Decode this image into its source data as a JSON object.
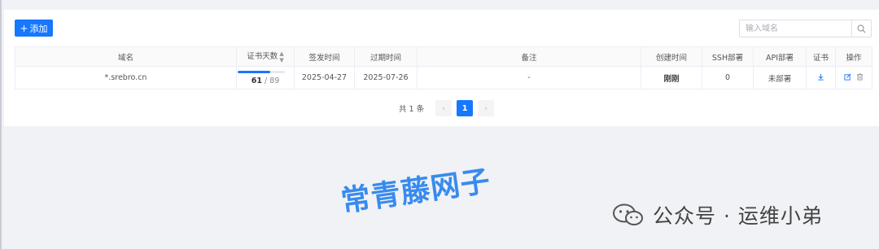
{
  "toolbar": {
    "add_label": "添加",
    "add_icon": "plus-icon"
  },
  "search": {
    "placeholder": "输入域名",
    "icon": "search-icon"
  },
  "table": {
    "columns": [
      "域名",
      "证书天数",
      "签发时间",
      "过期时间",
      "备注",
      "创建时间",
      "SSH部署",
      "API部署",
      "证书",
      "操作"
    ],
    "rows": [
      {
        "domain": "*.srebro.cn",
        "days_left": "61",
        "days_separator": " / ",
        "days_total": "89",
        "days_fraction": 0.685,
        "issued": "2025-04-27",
        "expires": "2025-07-26",
        "note": "-",
        "created": "刚刚",
        "ssh": "0",
        "api": "未部署",
        "cert_icon": "download-icon",
        "ops_icons": [
          "edit-icon",
          "delete-icon"
        ]
      }
    ]
  },
  "pagination": {
    "total_label": "共 1 条",
    "current_page": "1"
  },
  "watermark": {
    "title": "常青藤网子",
    "account": "公众号 · 运维小弟"
  },
  "colors": {
    "primary": "#1677ff",
    "watermark": "#2f86ee"
  }
}
